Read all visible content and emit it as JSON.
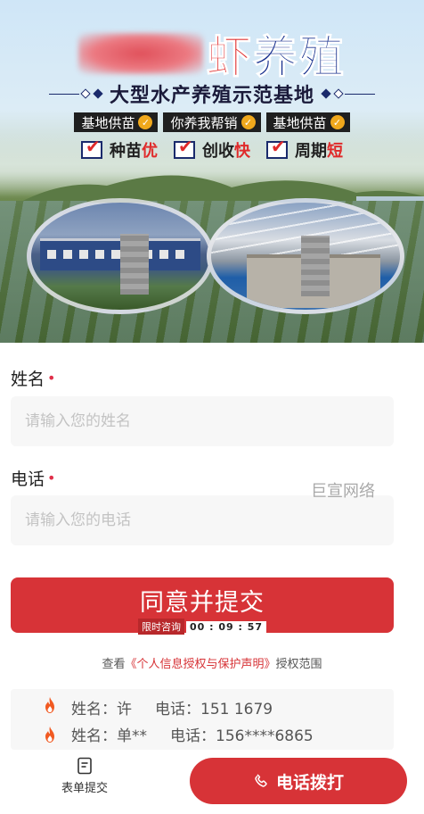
{
  "banner": {
    "brand_blurred": "",
    "brand_suffix_red": "虾",
    "brand_suffix_blue": "养殖",
    "subtitle": "大型水产养殖示范基地",
    "tags": [
      {
        "label": "基地供苗"
      },
      {
        "label": "你养我帮销"
      },
      {
        "label": "基地供苗"
      }
    ],
    "features": [
      {
        "prefix": "种苗",
        "highlight": "优"
      },
      {
        "prefix": "创收",
        "highlight": "快"
      },
      {
        "prefix": "周期",
        "highlight": "短"
      }
    ]
  },
  "form": {
    "name": {
      "label": "姓名",
      "required_mark": "•",
      "placeholder": "请输入您的姓名",
      "value": ""
    },
    "phone": {
      "label": "电话",
      "required_mark": "•",
      "placeholder": "请输入您的电话",
      "value": ""
    },
    "watermark": "巨宣网络",
    "submit_label": "同意并提交",
    "timer_label": "限时咨询",
    "timer_value": "00 : 09 : 57",
    "consent_prefix": "查看",
    "consent_link": "《个人信息授权与保护声明》",
    "consent_suffix": "授权范围"
  },
  "ticker": {
    "rows": [
      {
        "name": "姓名：许",
        "phone": "电话：151     1679"
      },
      {
        "name": "姓名：单**",
        "phone": "电话：156****6865"
      }
    ]
  },
  "bottom_bar": {
    "form_tab_label": "表单提交",
    "call_label": "电话拨打"
  },
  "colors": {
    "accent": "#d73337",
    "brand_red": "#e02a2a",
    "brand_blue": "#142d8c",
    "tag_badge": "#f0a81c",
    "fire": "#f15a22"
  },
  "icons": [
    "check-badge-icon",
    "checkbox-icon",
    "fire-icon",
    "form-doc-icon",
    "phone-icon"
  ]
}
